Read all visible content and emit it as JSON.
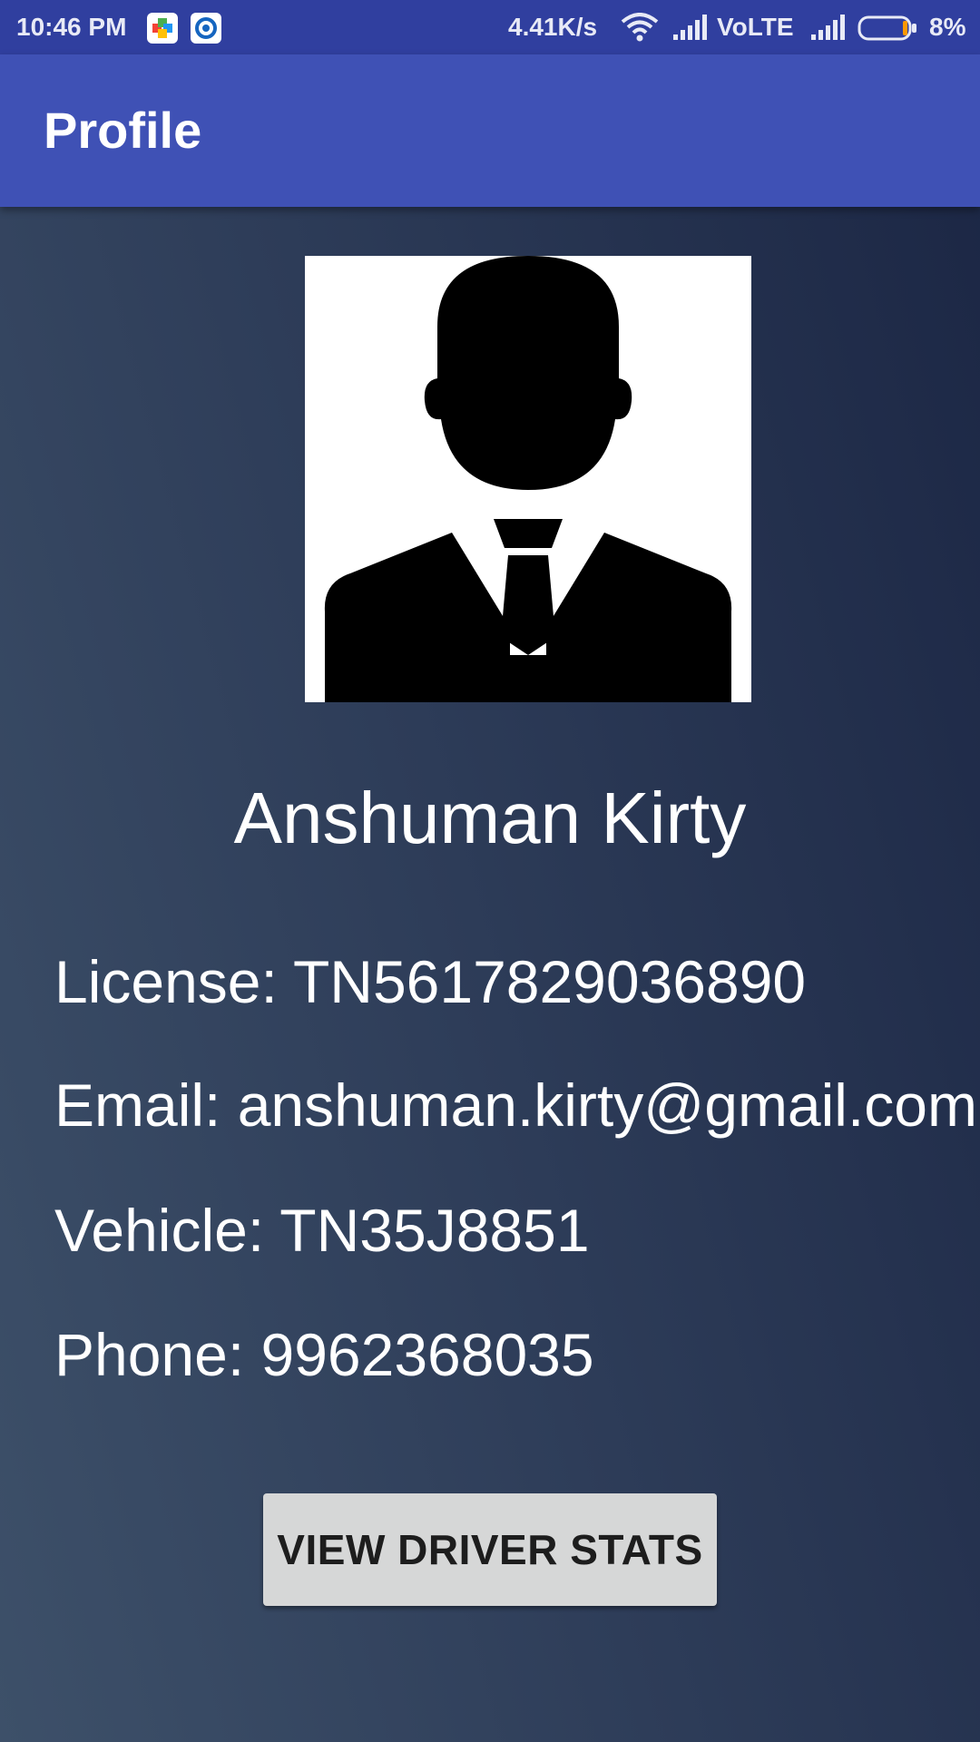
{
  "status_bar": {
    "time": "10:46 PM",
    "network_speed": "4.41K/s",
    "network_type": "VoLTE",
    "battery_level": "8%",
    "icons": [
      "play-games-icon",
      "camera-ring-icon",
      "wifi-icon",
      "signal-icon",
      "battery-icon"
    ]
  },
  "app_bar": {
    "title": "Profile",
    "color": "#3f51b5"
  },
  "profile": {
    "avatar_icon": "person-suit-silhouette-icon",
    "name": "Anshuman Kirty",
    "license": "License: TN5617829036890",
    "email": "Email: anshuman.kirty@gmail.com",
    "vehicle": "Vehicle: TN35J8851",
    "phone": "Phone: 9962368035"
  },
  "actions": {
    "view_stats_label": "VIEW DRIVER STATS"
  }
}
